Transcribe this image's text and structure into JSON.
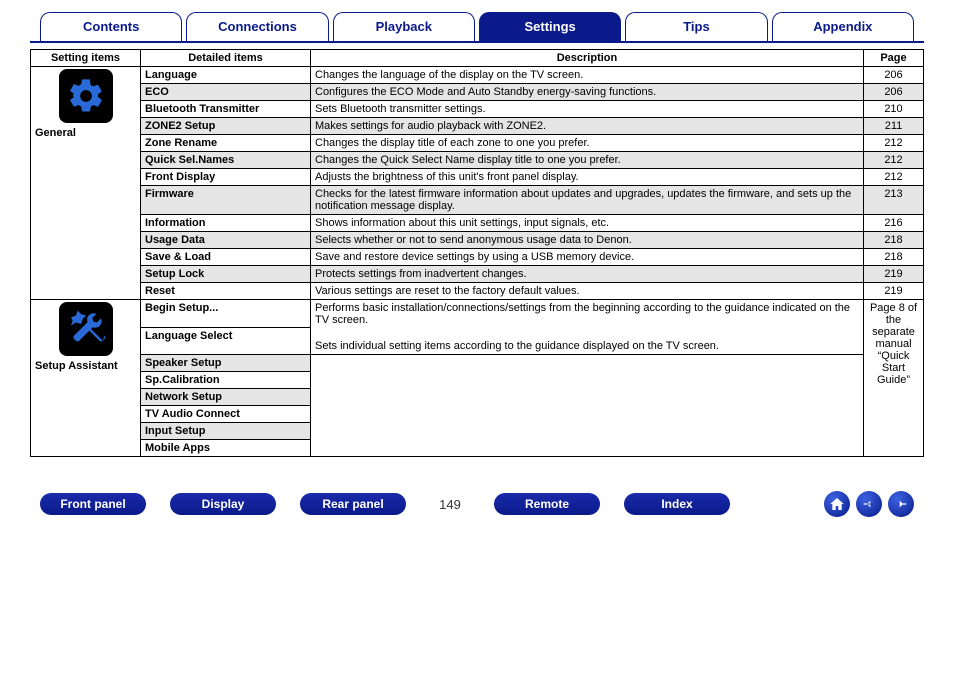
{
  "tabs": [
    "Contents",
    "Connections",
    "Playback",
    "Settings",
    "Tips",
    "Appendix"
  ],
  "active_tab": 3,
  "headers": {
    "setting": "Setting items",
    "detailed": "Detailed items",
    "description": "Description",
    "page": "Page"
  },
  "sections": [
    {
      "id": "general",
      "label": "General",
      "icon": "gear-icon",
      "rows": [
        {
          "detailed": "Language",
          "desc": "Changes the language of the display on the TV screen.",
          "page": "206",
          "shade": false
        },
        {
          "detailed": "ECO",
          "desc": "Configures the ECO Mode and Auto Standby energy-saving functions.",
          "page": "206",
          "shade": true
        },
        {
          "detailed": "Bluetooth Transmitter",
          "desc": "Sets Bluetooth transmitter settings.",
          "page": "210",
          "shade": false
        },
        {
          "detailed": "ZONE2 Setup",
          "desc": "Makes settings for audio playback with ZONE2.",
          "page": "211",
          "shade": true
        },
        {
          "detailed": "Zone Rename",
          "desc": "Changes the display title of each zone to one you prefer.",
          "page": "212",
          "shade": false
        },
        {
          "detailed": "Quick Sel.Names",
          "desc": "Changes the Quick Select Name display title to one you prefer.",
          "page": "212",
          "shade": true
        },
        {
          "detailed": "Front Display",
          "desc": "Adjusts the brightness of this unit's front panel display.",
          "page": "212",
          "shade": false
        },
        {
          "detailed": "Firmware",
          "desc": "Checks for the latest firmware information about updates and upgrades, updates the firmware, and sets up the notification message display.",
          "page": "213",
          "shade": true
        },
        {
          "detailed": "Information",
          "desc": "Shows information about this unit settings, input signals, etc.",
          "page": "216",
          "shade": false
        },
        {
          "detailed": "Usage Data",
          "desc": "Selects whether or not to send anonymous usage data to Denon.",
          "page": "218",
          "shade": true
        },
        {
          "detailed": "Save & Load",
          "desc": "Save and restore device settings by using a USB memory device.",
          "page": "218",
          "shade": false
        },
        {
          "detailed": "Setup Lock",
          "desc": "Protects settings from inadvertent changes.",
          "page": "219",
          "shade": true
        },
        {
          "detailed": "Reset",
          "desc": "Various settings are reset to the factory default values.",
          "page": "219",
          "shade": false
        }
      ]
    },
    {
      "id": "setup-assistant",
      "label": "Setup Assistant",
      "icon": "tools-icon",
      "page_note": "Page 8 of the separate manual “Quick Start Guide”",
      "rows": [
        {
          "detailed": "Begin Setup...",
          "desc": "Performs basic installation/connections/settings from the beginning according to the guidance indicated on the TV screen.",
          "shade": false
        },
        {
          "detailed": "Language Select",
          "desc": "Sets individual setting items according to the guidance displayed on the TV screen.",
          "shade": false
        },
        {
          "detailed": "Speaker Setup",
          "desc": "",
          "shade": true
        },
        {
          "detailed": "Sp.Calibration",
          "desc": "",
          "shade": false
        },
        {
          "detailed": "Network Setup",
          "desc": "",
          "shade": true
        },
        {
          "detailed": "TV Audio Connect",
          "desc": "",
          "shade": false
        },
        {
          "detailed": "Input Setup",
          "desc": "",
          "shade": true
        },
        {
          "detailed": "Mobile Apps",
          "desc": "",
          "shade": false
        }
      ]
    }
  ],
  "footer": {
    "buttons": [
      "Front panel",
      "Display",
      "Rear panel",
      "Remote",
      "Index"
    ],
    "page_number": "149"
  }
}
